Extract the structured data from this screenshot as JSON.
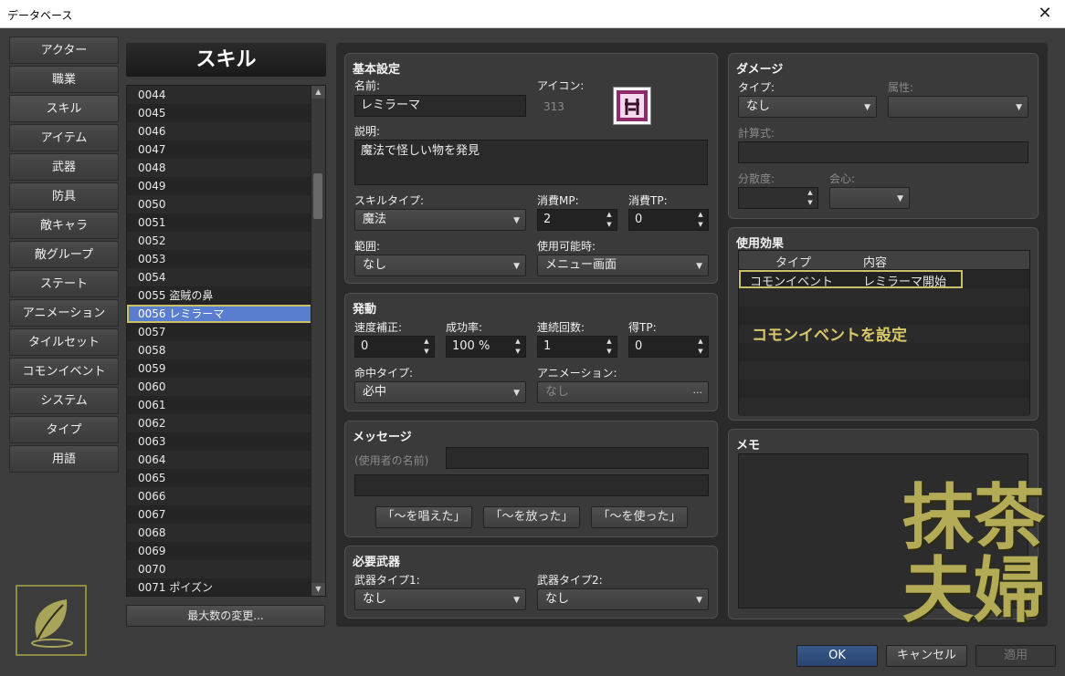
{
  "window": {
    "title": "データベース",
    "close_glyph": "✕"
  },
  "nav": {
    "items": [
      {
        "label": "アクター"
      },
      {
        "label": "職業"
      },
      {
        "label": "スキル"
      },
      {
        "label": "アイテム"
      },
      {
        "label": "武器"
      },
      {
        "label": "防具"
      },
      {
        "label": "敵キャラ"
      },
      {
        "label": "敵グループ"
      },
      {
        "label": "ステート"
      },
      {
        "label": "アニメーション"
      },
      {
        "label": "タイルセット"
      },
      {
        "label": "コモンイベント"
      },
      {
        "label": "システム"
      },
      {
        "label": "タイプ"
      },
      {
        "label": "用語"
      }
    ],
    "active_index": 2
  },
  "list": {
    "title": "スキル",
    "rows": [
      "0044",
      "0045",
      "0046",
      "0047",
      "0048",
      "0049",
      "0050",
      "0051",
      "0052",
      "0053",
      "0054",
      "0055 盗賊の鼻",
      "0056 レミラーマ",
      "0057",
      "0058",
      "0059",
      "0060",
      "0061",
      "0062",
      "0063",
      "0064",
      "0065",
      "0066",
      "0067",
      "0068",
      "0069",
      "0070",
      "0071 ポイズン"
    ],
    "selected_index": 12,
    "max_button": "最大数の変更..."
  },
  "basic": {
    "title": "基本設定",
    "name_label": "名前:",
    "name_value": "レミラーマ",
    "icon_label": "アイコン:",
    "icon_index": "313",
    "desc_label": "説明:",
    "desc_value": "魔法で怪しい物を発見",
    "skilltype_label": "スキルタイプ:",
    "skilltype_value": "魔法",
    "mp_label": "消費MP:",
    "mp_value": "2",
    "tp_label": "消費TP:",
    "tp_value": "0",
    "scope_label": "範囲:",
    "scope_value": "なし",
    "occasion_label": "使用可能時:",
    "occasion_value": "メニュー画面"
  },
  "invocation": {
    "title": "発動",
    "speed_label": "速度補正:",
    "speed_value": "0",
    "success_label": "成功率:",
    "success_value": "100 %",
    "repeat_label": "連続回数:",
    "repeat_value": "1",
    "tpgain_label": "得TP:",
    "tpgain_value": "0",
    "hittype_label": "命中タイプ:",
    "hittype_value": "必中",
    "anim_label": "アニメーション:",
    "anim_value": "なし",
    "anim_more": "···"
  },
  "message": {
    "title": "メッセージ",
    "placeholder": "(使用者の名前)",
    "btn1": "「〜を唱えた」",
    "btn2": "「〜を放った」",
    "btn3": "「〜を使った」"
  },
  "weapons": {
    "title": "必要武器",
    "w1_label": "武器タイプ1:",
    "w1_value": "なし",
    "w2_label": "武器タイプ2:",
    "w2_value": "なし"
  },
  "damage": {
    "title": "ダメージ",
    "type_label": "タイプ:",
    "type_value": "なし",
    "element_label": "属性:",
    "formula_label": "計算式:",
    "variance_label": "分散度:",
    "critical_label": "会心:"
  },
  "effects": {
    "title": "使用効果",
    "col_type": "タイプ",
    "col_content": "内容",
    "rows": [
      {
        "type": "コモンイベント",
        "content": "レミラーマ開始"
      }
    ],
    "annotation": "コモンイベントを設定"
  },
  "memo": {
    "title": "メモ"
  },
  "watermark": {
    "line1": "抹茶",
    "line2": "夫婦"
  },
  "footer": {
    "ok": "OK",
    "cancel": "キャンセル",
    "apply": "適用"
  },
  "colors": {
    "accent_select": "#5a7ecf",
    "highlight_outline": "#c9c06a",
    "ok_button": "#2f4f7e"
  }
}
